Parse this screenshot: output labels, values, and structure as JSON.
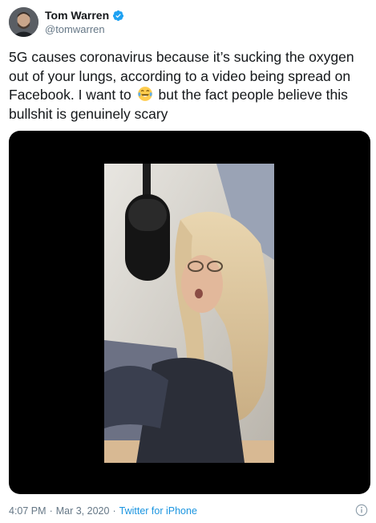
{
  "author": {
    "display_name": "Tom Warren",
    "handle": "@tomwarren",
    "verified": true,
    "avatar_icon": "avatar-photo"
  },
  "tweet": {
    "text_before_emoji": "5G causes coronavirus because it’s sucking the oxygen out of your lungs, according to a video being spread on Facebook. I want to",
    "emoji": "face-with-tears-of-joy",
    "text_after_emoji": "but the fact people believe this bullshit is genuinely scary"
  },
  "media": {
    "type": "video",
    "description_icon": "video-thumbnail"
  },
  "meta": {
    "time": "4:07 PM",
    "separator": "·",
    "date": "Mar 3, 2020",
    "source": "Twitter for iPhone",
    "info_icon": "tweet-info-icon"
  },
  "colors": {
    "verified": "#1da1f2",
    "link": "#1b95e0",
    "secondary_text": "#657786",
    "media_background": "#000000"
  }
}
